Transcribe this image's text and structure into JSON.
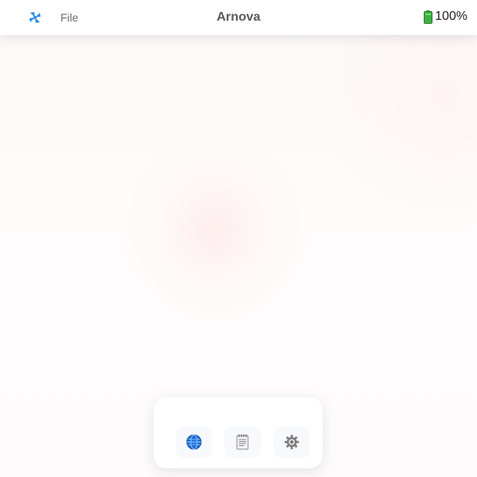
{
  "menubar": {
    "app_icon": "pinwheel-app-icon",
    "file_menu_label": "File",
    "window_title": "Arnova",
    "battery": {
      "icon": "battery-icon",
      "percent_label": "100%"
    }
  },
  "dock": {
    "items": [
      {
        "icon": "globe-icon",
        "app": "browser"
      },
      {
        "icon": "notepad-icon",
        "app": "notes"
      },
      {
        "icon": "gear-icon",
        "app": "settings"
      }
    ]
  },
  "colors": {
    "accent": "#2b8fe8",
    "menubar_bg": "#ffffff",
    "desktop_bg": "#fefcfc",
    "battery_green": "#3cb043"
  }
}
